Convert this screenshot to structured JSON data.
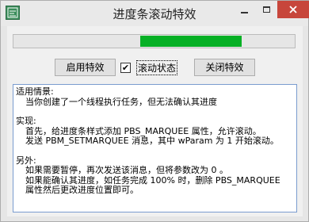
{
  "window": {
    "title": "进度条滚动特效"
  },
  "progress": {
    "fill_start_fraction": 0.45,
    "fill_end_fraction": 0.81,
    "fill_color": "#06b025"
  },
  "controls": {
    "start_button": "启用特效",
    "checkbox_label": "滚动状态",
    "checkbox_checked": true,
    "stop_button": "关闭特效"
  },
  "info": {
    "heading_1": "适用情景:",
    "line_1_1": "当你创建了一个线程执行任务，但无法确认其进度",
    "heading_2": "实现:",
    "line_2_1": "首先，给进度条样式添加 PBS_MARQUEE 属性，允许滚动。",
    "line_2_2": "发送 PBM_SETMARQUEE 消息，其中 wParam 为 1 开始滚动。",
    "heading_3": "另外:",
    "line_3_1": "如果需要暂停，再次发送该消息，但将参数改为 0 。",
    "line_3_2": "如果能确认其进度，如任务完成 100% 时，删除 PBS_MARQUEE",
    "line_3_3": "属性然后更改进度位置即可。"
  },
  "icons": {
    "app": "app-icon",
    "minimize": "minimize-icon",
    "maximize": "maximize-icon",
    "close": "close-icon"
  }
}
